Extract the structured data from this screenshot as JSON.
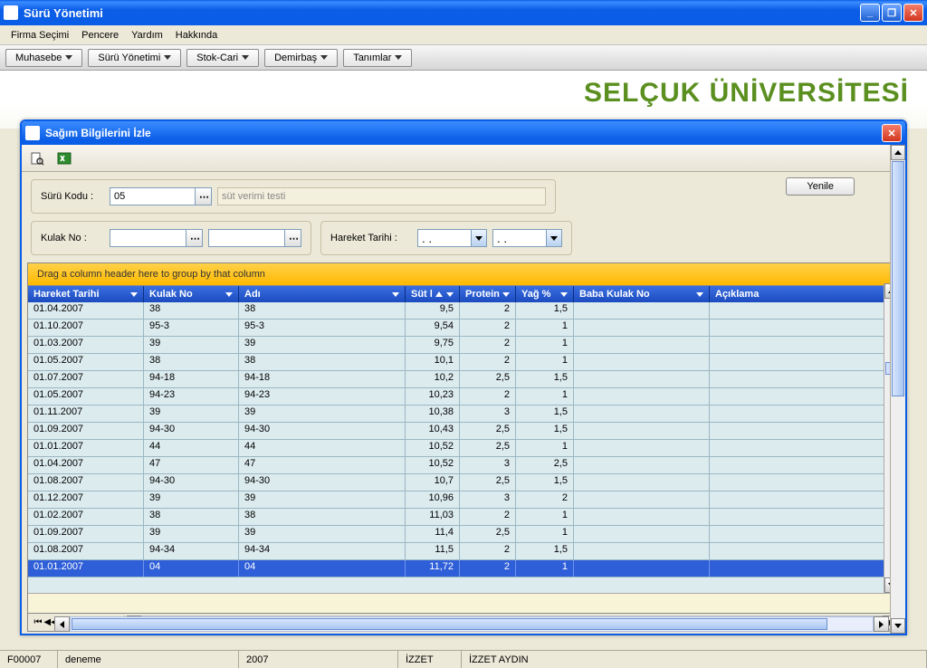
{
  "main_window": {
    "title": "Sürü Yönetimi",
    "menu": [
      "Firma Seçimi",
      "Pencere",
      "Yardım",
      "Hakkında"
    ]
  },
  "toolbar": [
    "Muhasebe",
    "Sürü Yönetimi",
    "Stok-Cari",
    "Demirbaş",
    "Tanımlar"
  ],
  "brand": {
    "line1": "SELÇUK ÜNİVERSİTESİ"
  },
  "inner_window": {
    "title": "Sağım Bilgilerini İzle"
  },
  "form": {
    "suru_kodu_label": "Sürü Kodu :",
    "suru_kodu_value": "05",
    "suru_name_placeholder": "süt verimi testi",
    "kulak_no_label": "Kulak No :",
    "hareket_tarihi_label": "Hareket Tarihi :",
    "date_from": ". .",
    "date_to": ". .",
    "yenile_label": "Yenile"
  },
  "grid": {
    "grouping_text": "Drag a column header here to group by that column",
    "columns": {
      "hareket_tarihi": "Hareket Tarihi",
      "kulak_no": "Kulak No",
      "adi": "Adı",
      "sut": "Süt l",
      "protein": "Protein",
      "yag": "Yağ %",
      "baba_kulak_no": "Baba Kulak No",
      "aciklama": "Açıklama"
    },
    "rows": [
      {
        "ht": "01.04.2007",
        "kn": "38",
        "ad": "38",
        "sl": "9,5",
        "pr": "2",
        "yg": "1,5",
        "bkn": "",
        "ac": ""
      },
      {
        "ht": "01.10.2007",
        "kn": "95-3",
        "ad": "95-3",
        "sl": "9,54",
        "pr": "2",
        "yg": "1",
        "bkn": "",
        "ac": ""
      },
      {
        "ht": "01.03.2007",
        "kn": "39",
        "ad": "39",
        "sl": "9,75",
        "pr": "2",
        "yg": "1",
        "bkn": "",
        "ac": ""
      },
      {
        "ht": "01.05.2007",
        "kn": "38",
        "ad": "38",
        "sl": "10,1",
        "pr": "2",
        "yg": "1",
        "bkn": "",
        "ac": ""
      },
      {
        "ht": "01.07.2007",
        "kn": "94-18",
        "ad": "94-18",
        "sl": "10,2",
        "pr": "2,5",
        "yg": "1,5",
        "bkn": "",
        "ac": ""
      },
      {
        "ht": "01.05.2007",
        "kn": "94-23",
        "ad": "94-23",
        "sl": "10,23",
        "pr": "2",
        "yg": "1",
        "bkn": "",
        "ac": ""
      },
      {
        "ht": "01.11.2007",
        "kn": "39",
        "ad": "39",
        "sl": "10,38",
        "pr": "3",
        "yg": "1,5",
        "bkn": "",
        "ac": ""
      },
      {
        "ht": "01.09.2007",
        "kn": "94-30",
        "ad": "94-30",
        "sl": "10,43",
        "pr": "2,5",
        "yg": "1,5",
        "bkn": "",
        "ac": ""
      },
      {
        "ht": "01.01.2007",
        "kn": "44",
        "ad": "44",
        "sl": "10,52",
        "pr": "2,5",
        "yg": "1",
        "bkn": "",
        "ac": ""
      },
      {
        "ht": "01.04.2007",
        "kn": "47",
        "ad": "47",
        "sl": "10,52",
        "pr": "3",
        "yg": "2,5",
        "bkn": "",
        "ac": ""
      },
      {
        "ht": "01.08.2007",
        "kn": "94-30",
        "ad": "94-30",
        "sl": "10,7",
        "pr": "2,5",
        "yg": "1,5",
        "bkn": "",
        "ac": ""
      },
      {
        "ht": "01.12.2007",
        "kn": "39",
        "ad": "39",
        "sl": "10,96",
        "pr": "3",
        "yg": "2",
        "bkn": "",
        "ac": ""
      },
      {
        "ht": "01.02.2007",
        "kn": "38",
        "ad": "38",
        "sl": "11,03",
        "pr": "2",
        "yg": "1",
        "bkn": "",
        "ac": ""
      },
      {
        "ht": "01.09.2007",
        "kn": "39",
        "ad": "39",
        "sl": "11,4",
        "pr": "2,5",
        "yg": "1",
        "bkn": "",
        "ac": ""
      },
      {
        "ht": "01.08.2007",
        "kn": "94-34",
        "ad": "94-34",
        "sl": "11,5",
        "pr": "2",
        "yg": "1,5",
        "bkn": "",
        "ac": ""
      },
      {
        "ht": "01.01.2007",
        "kn": "04",
        "ad": "04",
        "sl": "11,72",
        "pr": "2",
        "yg": "1",
        "bkn": "",
        "ac": ""
      }
    ],
    "selected_index": 15
  },
  "statusbar": {
    "cells": [
      "F00007",
      "deneme",
      "2007",
      "İZZET",
      "İZZET AYDIN"
    ]
  }
}
